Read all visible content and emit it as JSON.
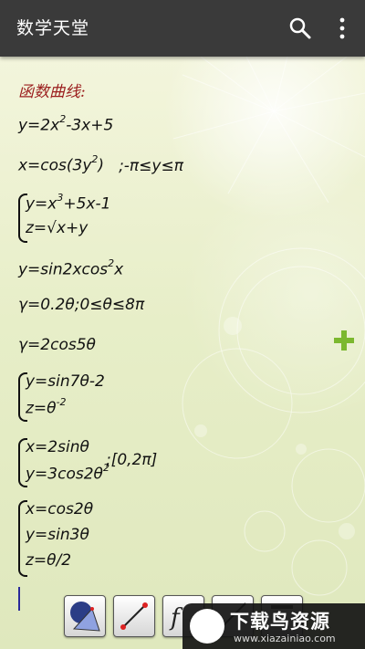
{
  "app": {
    "title": "数学天堂"
  },
  "icons": {
    "search": "search-icon",
    "menu": "more-vert-icon",
    "add": "add-icon"
  },
  "formulas": {
    "heading": "函数曲线:",
    "f1": {
      "a": "y=2x",
      "sup": "2",
      "b": "-3x+5"
    },
    "f2": {
      "a": "x=cos(3y",
      "sup": "2",
      "b": ")",
      "range": ";-π≤y≤π"
    },
    "f3": {
      "l1a": "y=x",
      "l1sup": "3",
      "l1b": "+5x-1",
      "l2": "z=√x+y"
    },
    "f4": {
      "a": "y=sin2xcos",
      "sup": "2",
      "b": "x"
    },
    "f5": "γ=0.2θ;0≤θ≤8π",
    "f6": "γ=2cos5θ",
    "f7": {
      "l1": "y=sin7θ-2",
      "l2a": "z=θ",
      "l2sup": "-2"
    },
    "f8": {
      "l1": "x=2sinθ",
      "l2a": "y=3cos2θ",
      "l2sup": "2",
      "range": ";[0,2π]"
    },
    "f9": {
      "l1": "x=cos2θ",
      "l2": "y=sin3θ",
      "l3": "z=θ/2"
    }
  },
  "toolbar": {
    "items": [
      "cone-icon",
      "line-segment-icon",
      "function-icon",
      "line-icon",
      "list-icon"
    ]
  },
  "watermark": {
    "title": "下载鸟资源",
    "url": "www.xiazainiao.com"
  },
  "colors": {
    "appbar": "#3a3a3a",
    "heading": "#9b1e1e",
    "plus": "#7cb82f"
  }
}
